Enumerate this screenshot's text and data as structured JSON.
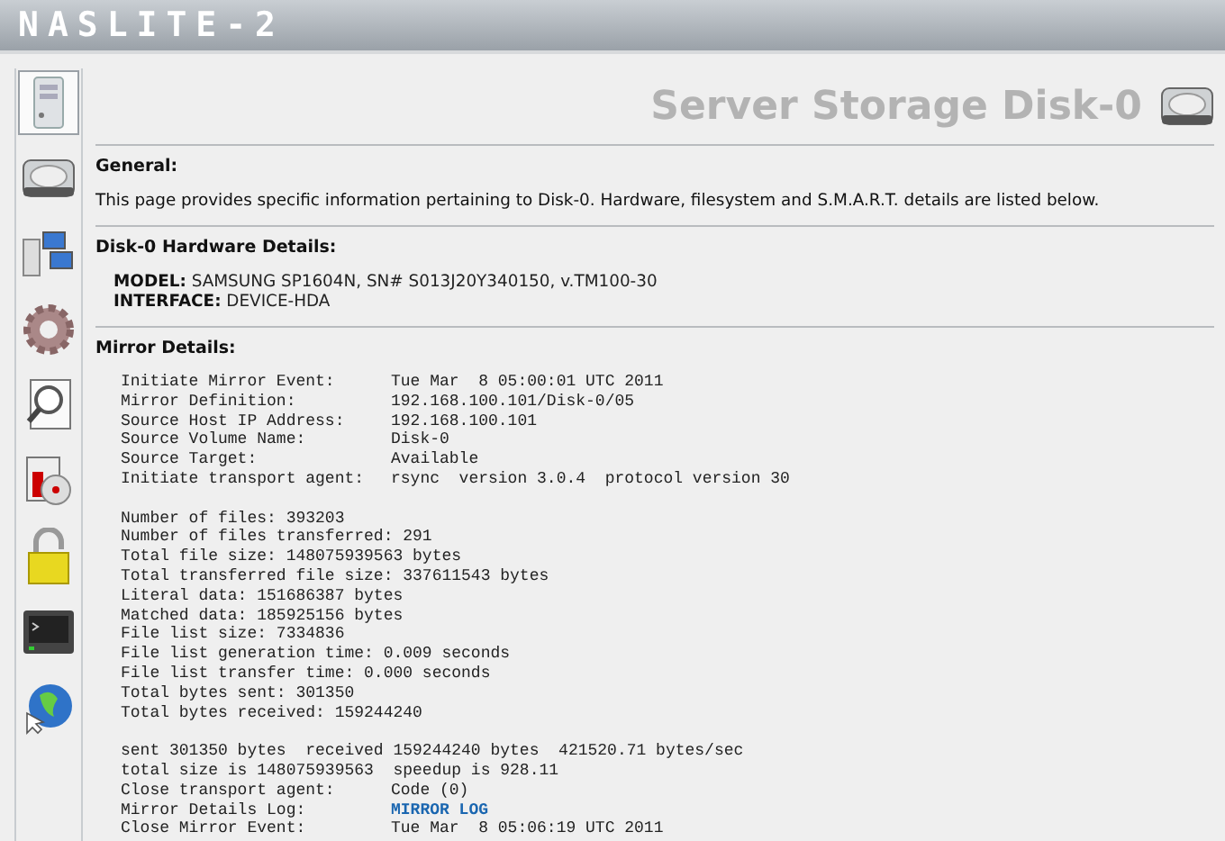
{
  "logo": "NASLITE-2",
  "nav": [
    {
      "kind": "server",
      "selected": true
    },
    {
      "kind": "disk",
      "selected": false
    },
    {
      "kind": "network",
      "selected": false
    },
    {
      "kind": "gear",
      "selected": false
    },
    {
      "kind": "search",
      "selected": false
    },
    {
      "kind": "media",
      "selected": false
    },
    {
      "kind": "lock",
      "selected": false
    },
    {
      "kind": "terminal",
      "selected": false
    },
    {
      "kind": "globe",
      "selected": false
    }
  ],
  "title": "Server Storage Disk-0",
  "general": {
    "heading": "General:",
    "text": "This page provides specific information pertaining to Disk-0. Hardware, filesystem and S.M.A.R.T. details are listed below."
  },
  "hardware": {
    "heading": "Disk-0 Hardware Details:",
    "fields": [
      {
        "label": "MODEL:",
        "value": "SAMSUNG SP1604N, SN# S013J20Y340150, v.TM100-30"
      },
      {
        "label": "INTERFACE:",
        "value": "DEVICE-HDA"
      }
    ]
  },
  "mirror": {
    "heading": "Mirror Details:",
    "events": [
      {
        "label": "Initiate Mirror Event:",
        "value": "Tue Mar  8 05:00:01 UTC 2011"
      },
      {
        "label": "Mirror Definition:",
        "value": "192.168.100.101/Disk-0/05"
      },
      {
        "label": "Source Host IP Address:",
        "value": "192.168.100.101"
      },
      {
        "label": "Source Volume Name:",
        "value": "Disk-0"
      },
      {
        "label": "Source Target:",
        "value": "Available"
      },
      {
        "label": "Initiate transport agent:",
        "value": "rsync  version 3.0.4  protocol version 30"
      }
    ],
    "stats": [
      "Number of files: 393203",
      "Number of files transferred: 291",
      "Total file size: 148075939563 bytes",
      "Total transferred file size: 337611543 bytes",
      "Literal data: 151686387 bytes",
      "Matched data: 185925156 bytes",
      "File list size: 7334836",
      "File list generation time: 0.009 seconds",
      "File list transfer time: 0.000 seconds",
      "Total bytes sent: 301350",
      "Total bytes received: 159244240"
    ],
    "summary": [
      "sent 301350 bytes  received 159244240 bytes  421520.71 bytes/sec",
      "total size is 148075939563  speedup is 928.11"
    ],
    "closing": [
      {
        "label": "Close transport agent:",
        "value": "Code (0)",
        "kind": "text"
      },
      {
        "label": "Mirror Details Log:",
        "value": "MIRROR LOG",
        "kind": "link"
      },
      {
        "label": "Close Mirror Event:",
        "value": "Tue Mar  8 05:06:19 UTC 2011",
        "kind": "text"
      }
    ]
  }
}
